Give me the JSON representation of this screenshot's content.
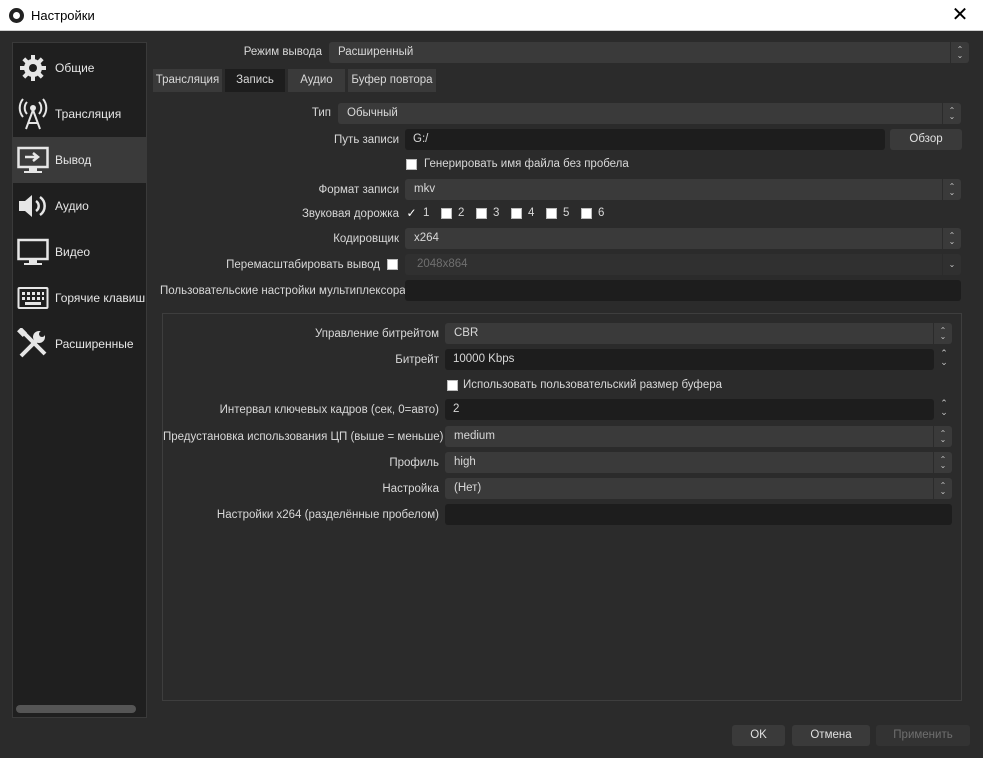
{
  "window": {
    "title": "Настройки",
    "close_glyph": "✕"
  },
  "sidebar": {
    "items": [
      {
        "label": "Общие",
        "icon": "gear-icon"
      },
      {
        "label": "Трансляция",
        "icon": "antenna-icon"
      },
      {
        "label": "Вывод",
        "icon": "output-icon"
      },
      {
        "label": "Аудио",
        "icon": "speaker-icon"
      },
      {
        "label": "Видео",
        "icon": "monitor-icon"
      },
      {
        "label": "Горячие клавиш",
        "icon": "keyboard-icon"
      },
      {
        "label": "Расширенные",
        "icon": "tools-icon"
      }
    ],
    "active_index": 2
  },
  "output_mode": {
    "label": "Режим вывода",
    "value": "Расширенный"
  },
  "tabs": [
    {
      "label": "Трансляция"
    },
    {
      "label": "Запись"
    },
    {
      "label": "Аудио"
    },
    {
      "label": "Буфер повтора"
    }
  ],
  "active_tab": "Запись",
  "recording": {
    "type_label": "Тип",
    "type_value": "Обычный",
    "path_label": "Путь записи",
    "path_value": "G:/",
    "browse_label": "Обзор",
    "no_space_label": "Генерировать имя файла без пробела",
    "no_space_checked": false,
    "format_label": "Формат записи",
    "format_value": "mkv",
    "audio_track_label": "Звуковая дорожка",
    "tracks": [
      {
        "label": "1",
        "checked": true
      },
      {
        "label": "2",
        "checked": false
      },
      {
        "label": "3",
        "checked": false
      },
      {
        "label": "4",
        "checked": false
      },
      {
        "label": "5",
        "checked": false
      },
      {
        "label": "6",
        "checked": false
      }
    ],
    "encoder_label": "Кодировщик",
    "encoder_value": "x264",
    "rescale_label": "Перемасштабировать вывод",
    "rescale_checked": false,
    "rescale_value": "2048x864",
    "muxer_label": "Пользовательские настройки мультиплексора",
    "muxer_value": ""
  },
  "encoder_settings": {
    "rate_control_label": "Управление битрейтом",
    "rate_control_value": "CBR",
    "bitrate_label": "Битрейт",
    "bitrate_value": "10000 Kbps",
    "custom_buffer_label": "Использовать пользовательский размер буфера",
    "custom_buffer_checked": false,
    "keyframe_label": "Интервал ключевых кадров (сек, 0=авто)",
    "keyframe_value": "2",
    "preset_label": "Предустановка использования ЦП (выше = меньше)",
    "preset_value": "medium",
    "profile_label": "Профиль",
    "profile_value": "high",
    "tune_label": "Настройка",
    "tune_value": "(Нет)",
    "x264opts_label": "Настройки x264 (разделённые пробелом)",
    "x264opts_value": ""
  },
  "footer": {
    "ok_label": "OK",
    "cancel_label": "Отмена",
    "apply_label": "Применить"
  }
}
